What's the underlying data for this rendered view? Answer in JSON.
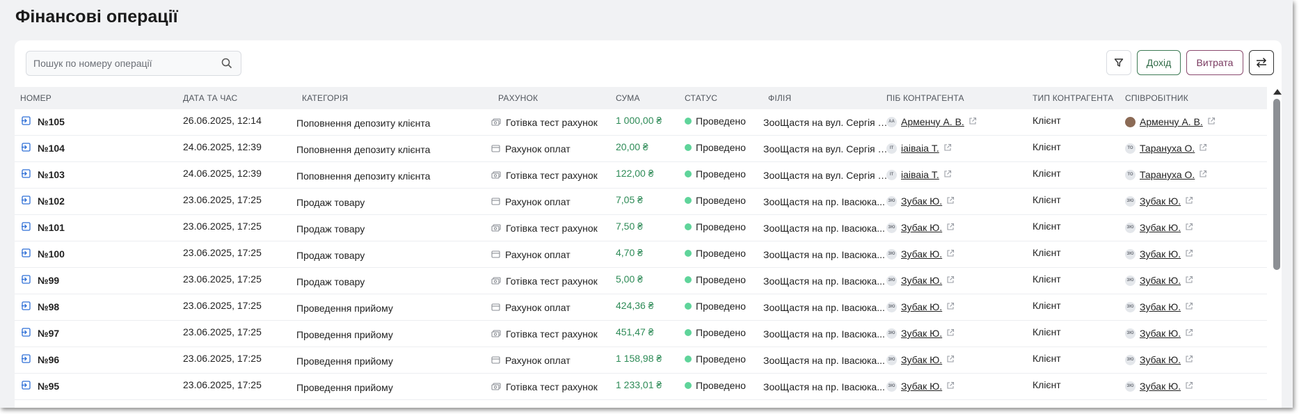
{
  "page": {
    "title": "Фінансові операції"
  },
  "search": {
    "placeholder": "Пошук по номеру операції"
  },
  "actions": {
    "income_label": "Дохід",
    "expense_label": "Витрата"
  },
  "table": {
    "headers": {
      "number": "НОМЕР",
      "datetime": "ДАТА ТА ЧАС",
      "category": "КАТЕГОРІЯ",
      "account": "РАХУНОК",
      "sum": "СУМА",
      "status": "СТАТУС",
      "branch": "ФІЛІЯ",
      "counterparty": "ПІБ КОНТРАГЕНТА",
      "counterparty_type": "ТИП КОНТРАГЕНТА",
      "employee": "СПІВРОБІТНИК"
    },
    "rows": [
      {
        "number": "№105",
        "date": "26.06.2025, 12:14",
        "category": "Поповнення депозиту клієнта",
        "account_icon": "cash-icon",
        "account": "Готівка тест рахунок",
        "sum": "1 000,00 ₴",
        "status": "Проведено",
        "branch": "ЗооЩастя на вул. Сергія Бо...",
        "contr_initials": "АА",
        "contr": "Арменчу А. В.",
        "type": "Клієнт",
        "emp_initials": "",
        "emp_photo": true,
        "emp": "Арменчу А. В."
      },
      {
        "number": "№104",
        "date": "24.06.2025, 12:39",
        "category": "Поповнення депозиту клієнта",
        "account_icon": "card-icon",
        "account": "Рахунок оплат",
        "sum": "20,00 ₴",
        "status": "Проведено",
        "branch": "ЗооЩастя на вул. Сергія Бо...",
        "contr_initials": "ІТ",
        "contr": "іаіваіа Т.",
        "type": "Клієнт",
        "emp_initials": "ТО",
        "emp_photo": false,
        "emp": "Тарануха О."
      },
      {
        "number": "№103",
        "date": "24.06.2025, 12:39",
        "category": "Поповнення депозиту клієнта",
        "account_icon": "cash-icon",
        "account": "Готівка тест рахунок",
        "sum": "122,00 ₴",
        "status": "Проведено",
        "branch": "ЗооЩастя на вул. Сергія Бо...",
        "contr_initials": "ІТ",
        "contr": "іаіваіа Т.",
        "type": "Клієнт",
        "emp_initials": "ТО",
        "emp_photo": false,
        "emp": "Тарануха О."
      },
      {
        "number": "№102",
        "date": "23.06.2025, 17:25",
        "category": "Продаж товару",
        "account_icon": "card-icon",
        "account": "Рахунок оплат",
        "sum": "7,05 ₴",
        "status": "Проведено",
        "branch": "ЗооЩастя на пр. Івасюка...",
        "contr_initials": "ЗЮ",
        "contr": "Зубак Ю.",
        "type": "Клієнт",
        "emp_initials": "ЗЮ",
        "emp_photo": false,
        "emp": "Зубак Ю."
      },
      {
        "number": "№101",
        "date": "23.06.2025, 17:25",
        "category": "Продаж товару",
        "account_icon": "cash-icon",
        "account": "Готівка тест рахунок",
        "sum": "7,50 ₴",
        "status": "Проведено",
        "branch": "ЗооЩастя на пр. Івасюка...",
        "contr_initials": "ЗЮ",
        "contr": "Зубак Ю.",
        "type": "Клієнт",
        "emp_initials": "ЗЮ",
        "emp_photo": false,
        "emp": "Зубак Ю."
      },
      {
        "number": "№100",
        "date": "23.06.2025, 17:25",
        "category": "Продаж товару",
        "account_icon": "card-icon",
        "account": "Рахунок оплат",
        "sum": "4,70 ₴",
        "status": "Проведено",
        "branch": "ЗооЩастя на пр. Івасюка...",
        "contr_initials": "ЗЮ",
        "contr": "Зубак Ю.",
        "type": "Клієнт",
        "emp_initials": "ЗЮ",
        "emp_photo": false,
        "emp": "Зубак Ю."
      },
      {
        "number": "№99",
        "date": "23.06.2025, 17:25",
        "category": "Продаж товару",
        "account_icon": "cash-icon",
        "account": "Готівка тест рахунок",
        "sum": "5,00 ₴",
        "status": "Проведено",
        "branch": "ЗооЩастя на пр. Івасюка...",
        "contr_initials": "ЗЮ",
        "contr": "Зубак Ю.",
        "type": "Клієнт",
        "emp_initials": "ЗЮ",
        "emp_photo": false,
        "emp": "Зубак Ю."
      },
      {
        "number": "№98",
        "date": "23.06.2025, 17:25",
        "category": "Проведення прийому",
        "account_icon": "card-icon",
        "account": "Рахунок оплат",
        "sum": "424,36 ₴",
        "status": "Проведено",
        "branch": "ЗооЩастя на пр. Івасюка...",
        "contr_initials": "ЗЮ",
        "contr": "Зубак Ю.",
        "type": "Клієнт",
        "emp_initials": "ЗЮ",
        "emp_photo": false,
        "emp": "Зубак Ю."
      },
      {
        "number": "№97",
        "date": "23.06.2025, 17:25",
        "category": "Проведення прийому",
        "account_icon": "cash-icon",
        "account": "Готівка тест рахунок",
        "sum": "451,47 ₴",
        "status": "Проведено",
        "branch": "ЗооЩастя на пр. Івасюка...",
        "contr_initials": "ЗЮ",
        "contr": "Зубак Ю.",
        "type": "Клієнт",
        "emp_initials": "ЗЮ",
        "emp_photo": false,
        "emp": "Зубак Ю."
      },
      {
        "number": "№96",
        "date": "23.06.2025, 17:25",
        "category": "Проведення прийому",
        "account_icon": "card-icon",
        "account": "Рахунок оплат",
        "sum": "1 158,98 ₴",
        "status": "Проведено",
        "branch": "ЗооЩастя на пр. Івасюка...",
        "contr_initials": "ЗЮ",
        "contr": "Зубак Ю.",
        "type": "Клієнт",
        "emp_initials": "ЗЮ",
        "emp_photo": false,
        "emp": "Зубак Ю."
      },
      {
        "number": "№95",
        "date": "23.06.2025, 17:25",
        "category": "Проведення прийому",
        "account_icon": "cash-icon",
        "account": "Готівка тест рахунок",
        "sum": "1 233,01 ₴",
        "status": "Проведено",
        "branch": "ЗооЩастя на пр. Івасюка...",
        "contr_initials": "ЗЮ",
        "contr": "Зубак Ю.",
        "type": "Клієнт",
        "emp_initials": "ЗЮ",
        "emp_photo": false,
        "emp": "Зубак Ю."
      }
    ]
  },
  "colors": {
    "sum_green": "#2e8b57",
    "status_dot": "#5fd49a",
    "income_border": "#3e7a55",
    "expense_border": "#8a4a6e",
    "row_icon_blue": "#2f6fd6"
  }
}
